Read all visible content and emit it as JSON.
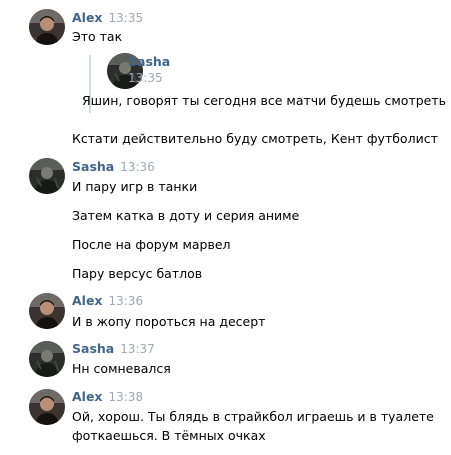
{
  "avatars": {
    "alex": "avatar-alex",
    "sasha": "avatar-sasha"
  },
  "colors": {
    "name": "#42648b",
    "time": "#a0a8b3",
    "quote_bar": "#d3d9de"
  },
  "messages": [
    {
      "author": "Alex",
      "time": "13:35",
      "lines": [
        "Это так"
      ],
      "forwarded": {
        "author": "Sasha",
        "time": "13:35",
        "text": "Яшин, говорят ты сегодня все матчи будешь смотреть"
      },
      "after": "Кстати действительно буду смотреть, Кент футболист"
    },
    {
      "author": "Sasha",
      "time": "13:36",
      "lines": [
        "И пару игр в танки",
        "Затем катка в доту и серия аниме",
        "После на форум марвел",
        "Пару версус батлов"
      ]
    },
    {
      "author": "Alex",
      "time": "13:36",
      "lines": [
        "И в жопу пороться на десерт"
      ]
    },
    {
      "author": "Sasha",
      "time": "13:37",
      "lines": [
        "Нн сомневался"
      ]
    },
    {
      "author": "Alex",
      "time": "13:38",
      "lines": [
        "Ой, хорош. Ты блядь в страйкбол играешь и в туалете",
        "фоткаешься. В тёмных очках"
      ]
    }
  ]
}
